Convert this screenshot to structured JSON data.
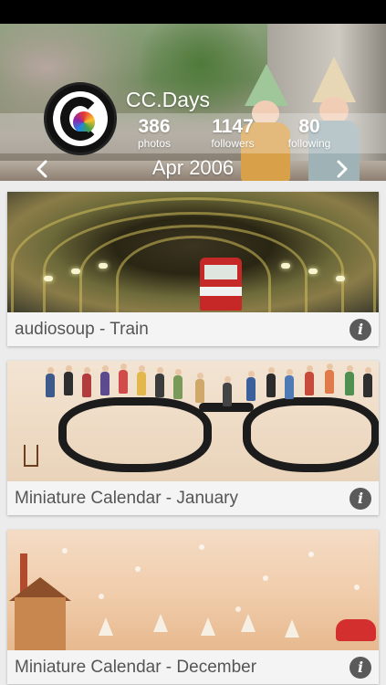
{
  "profile": {
    "name": "CC.Days",
    "stats": [
      {
        "value": "386",
        "label": "photos"
      },
      {
        "value": "1147",
        "label": "followers"
      },
      {
        "value": "80",
        "label": "following"
      }
    ]
  },
  "month": {
    "current": "Apr 2006",
    "prev_icon": "chevron-left-icon",
    "next_icon": "chevron-right-icon"
  },
  "feed": {
    "items": [
      {
        "caption": "audiosoup - Train",
        "info_icon": "info-icon"
      },
      {
        "caption": "Miniature Calendar - January",
        "info_icon": "info-icon"
      },
      {
        "caption": "Miniature Calendar - December",
        "info_icon": "info-icon"
      }
    ]
  },
  "colors": {
    "status_bar": "#000000",
    "caption_text": "#555555",
    "info_button": "#5a5a5a",
    "background": "#ececec"
  }
}
